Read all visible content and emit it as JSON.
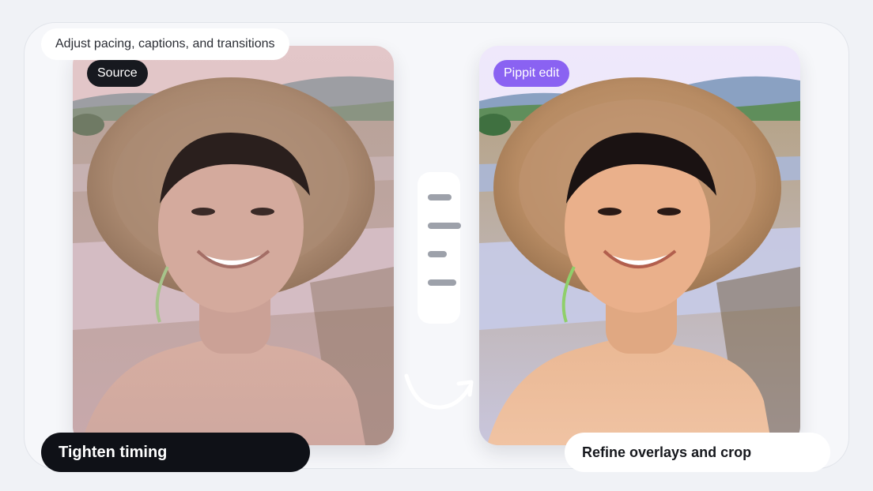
{
  "hint": "Adjust pacing, captions, and transitions",
  "source_label": "Source",
  "edit_label": "Pippit edit",
  "timing_label": "Tighten timing",
  "overlay_label": "Refine overlays and crop",
  "colors": {
    "edit_accent": "#8a62f2",
    "dark_card": "#0f1117"
  },
  "icons": [
    "timeline-bars-icon",
    "curved-arrow-icon"
  ]
}
